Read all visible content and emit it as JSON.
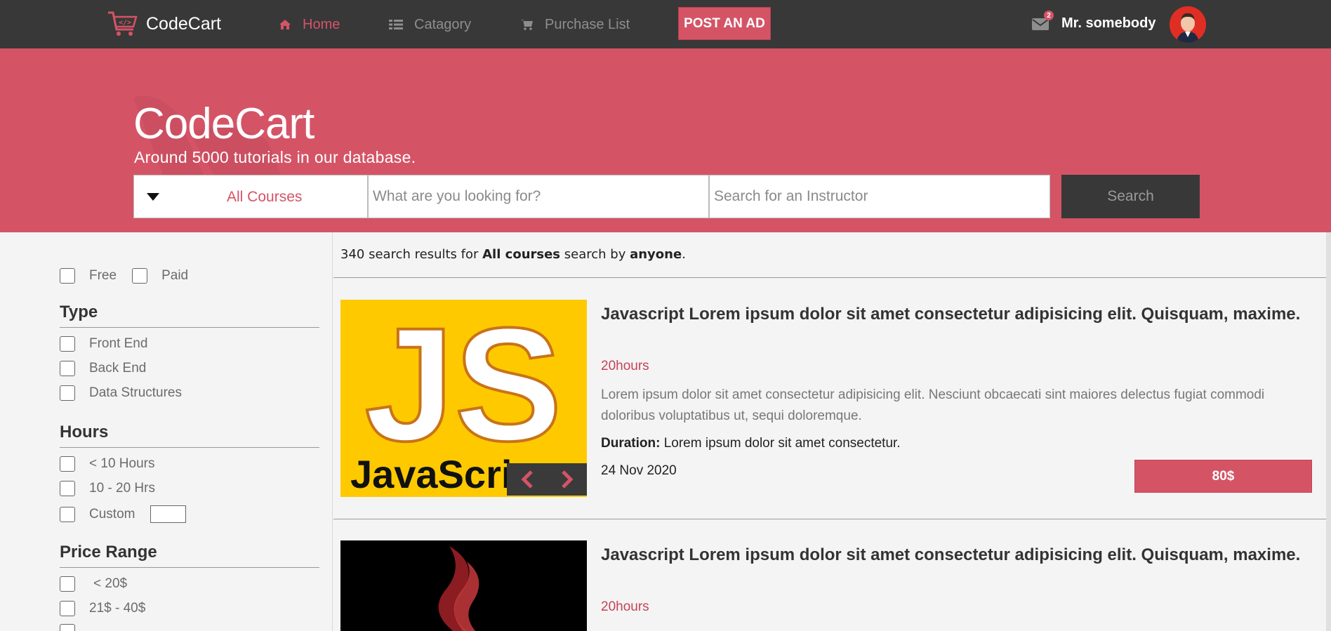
{
  "navbar": {
    "brand": "CodeCart",
    "home": "Home",
    "category": "Catagory",
    "purchase_list": "Purchase List",
    "post_ad": "POST AN AD",
    "mail_count": "2",
    "username": "Mr. somebody"
  },
  "hero": {
    "title": "CodeCart",
    "subtitle": "Around 5000 tutorials in our database.",
    "course_select": "All Courses",
    "what_placeholder": "What are you looking for?",
    "instructor_placeholder": "Search for an Instructor",
    "search_button": "Search"
  },
  "filters": {
    "price_free": "Free",
    "price_paid": "Paid",
    "type_heading": "Type",
    "type_items": [
      "Front End",
      "Back End",
      "Data Structures"
    ],
    "hours_heading": "Hours",
    "hours_items": [
      "< 10 Hours",
      "10 - 20 Hrs",
      "Custom"
    ],
    "price_range_heading": "Price Range",
    "price_range_items": [
      "< 20$",
      "21$ - 40$"
    ]
  },
  "results": {
    "count": "340",
    "text_1": "search results for",
    "query": "All courses",
    "text_2": "search by",
    "by": "anyone",
    "period": "."
  },
  "courses": [
    {
      "thumb_text": "JS",
      "thumb_caption": "JavaScri",
      "title": "Javascript Lorem ipsum dolor sit amet consectetur adipisicing elit. Quisquam, maxime.",
      "hours": "20hours",
      "description": "Lorem ipsum dolor sit amet consectetur adipisicing elit. Nesciunt obcaecati sint maiores delectus fugiat commodi doloribus voluptatibus ut, sequi doloremque.",
      "duration_label": "Duration:",
      "duration_text": "Lorem ipsum dolor sit amet consectetur.",
      "date": "24 Nov 2020",
      "price": "80$"
    },
    {
      "title": "Javascript Lorem ipsum dolor sit amet consectetur adipisicing elit. Quisquam, maxime.",
      "hours": "20hours"
    }
  ],
  "colors": {
    "accent": "#d45466",
    "dark": "#383838",
    "js_yellow": "#ffc900"
  }
}
